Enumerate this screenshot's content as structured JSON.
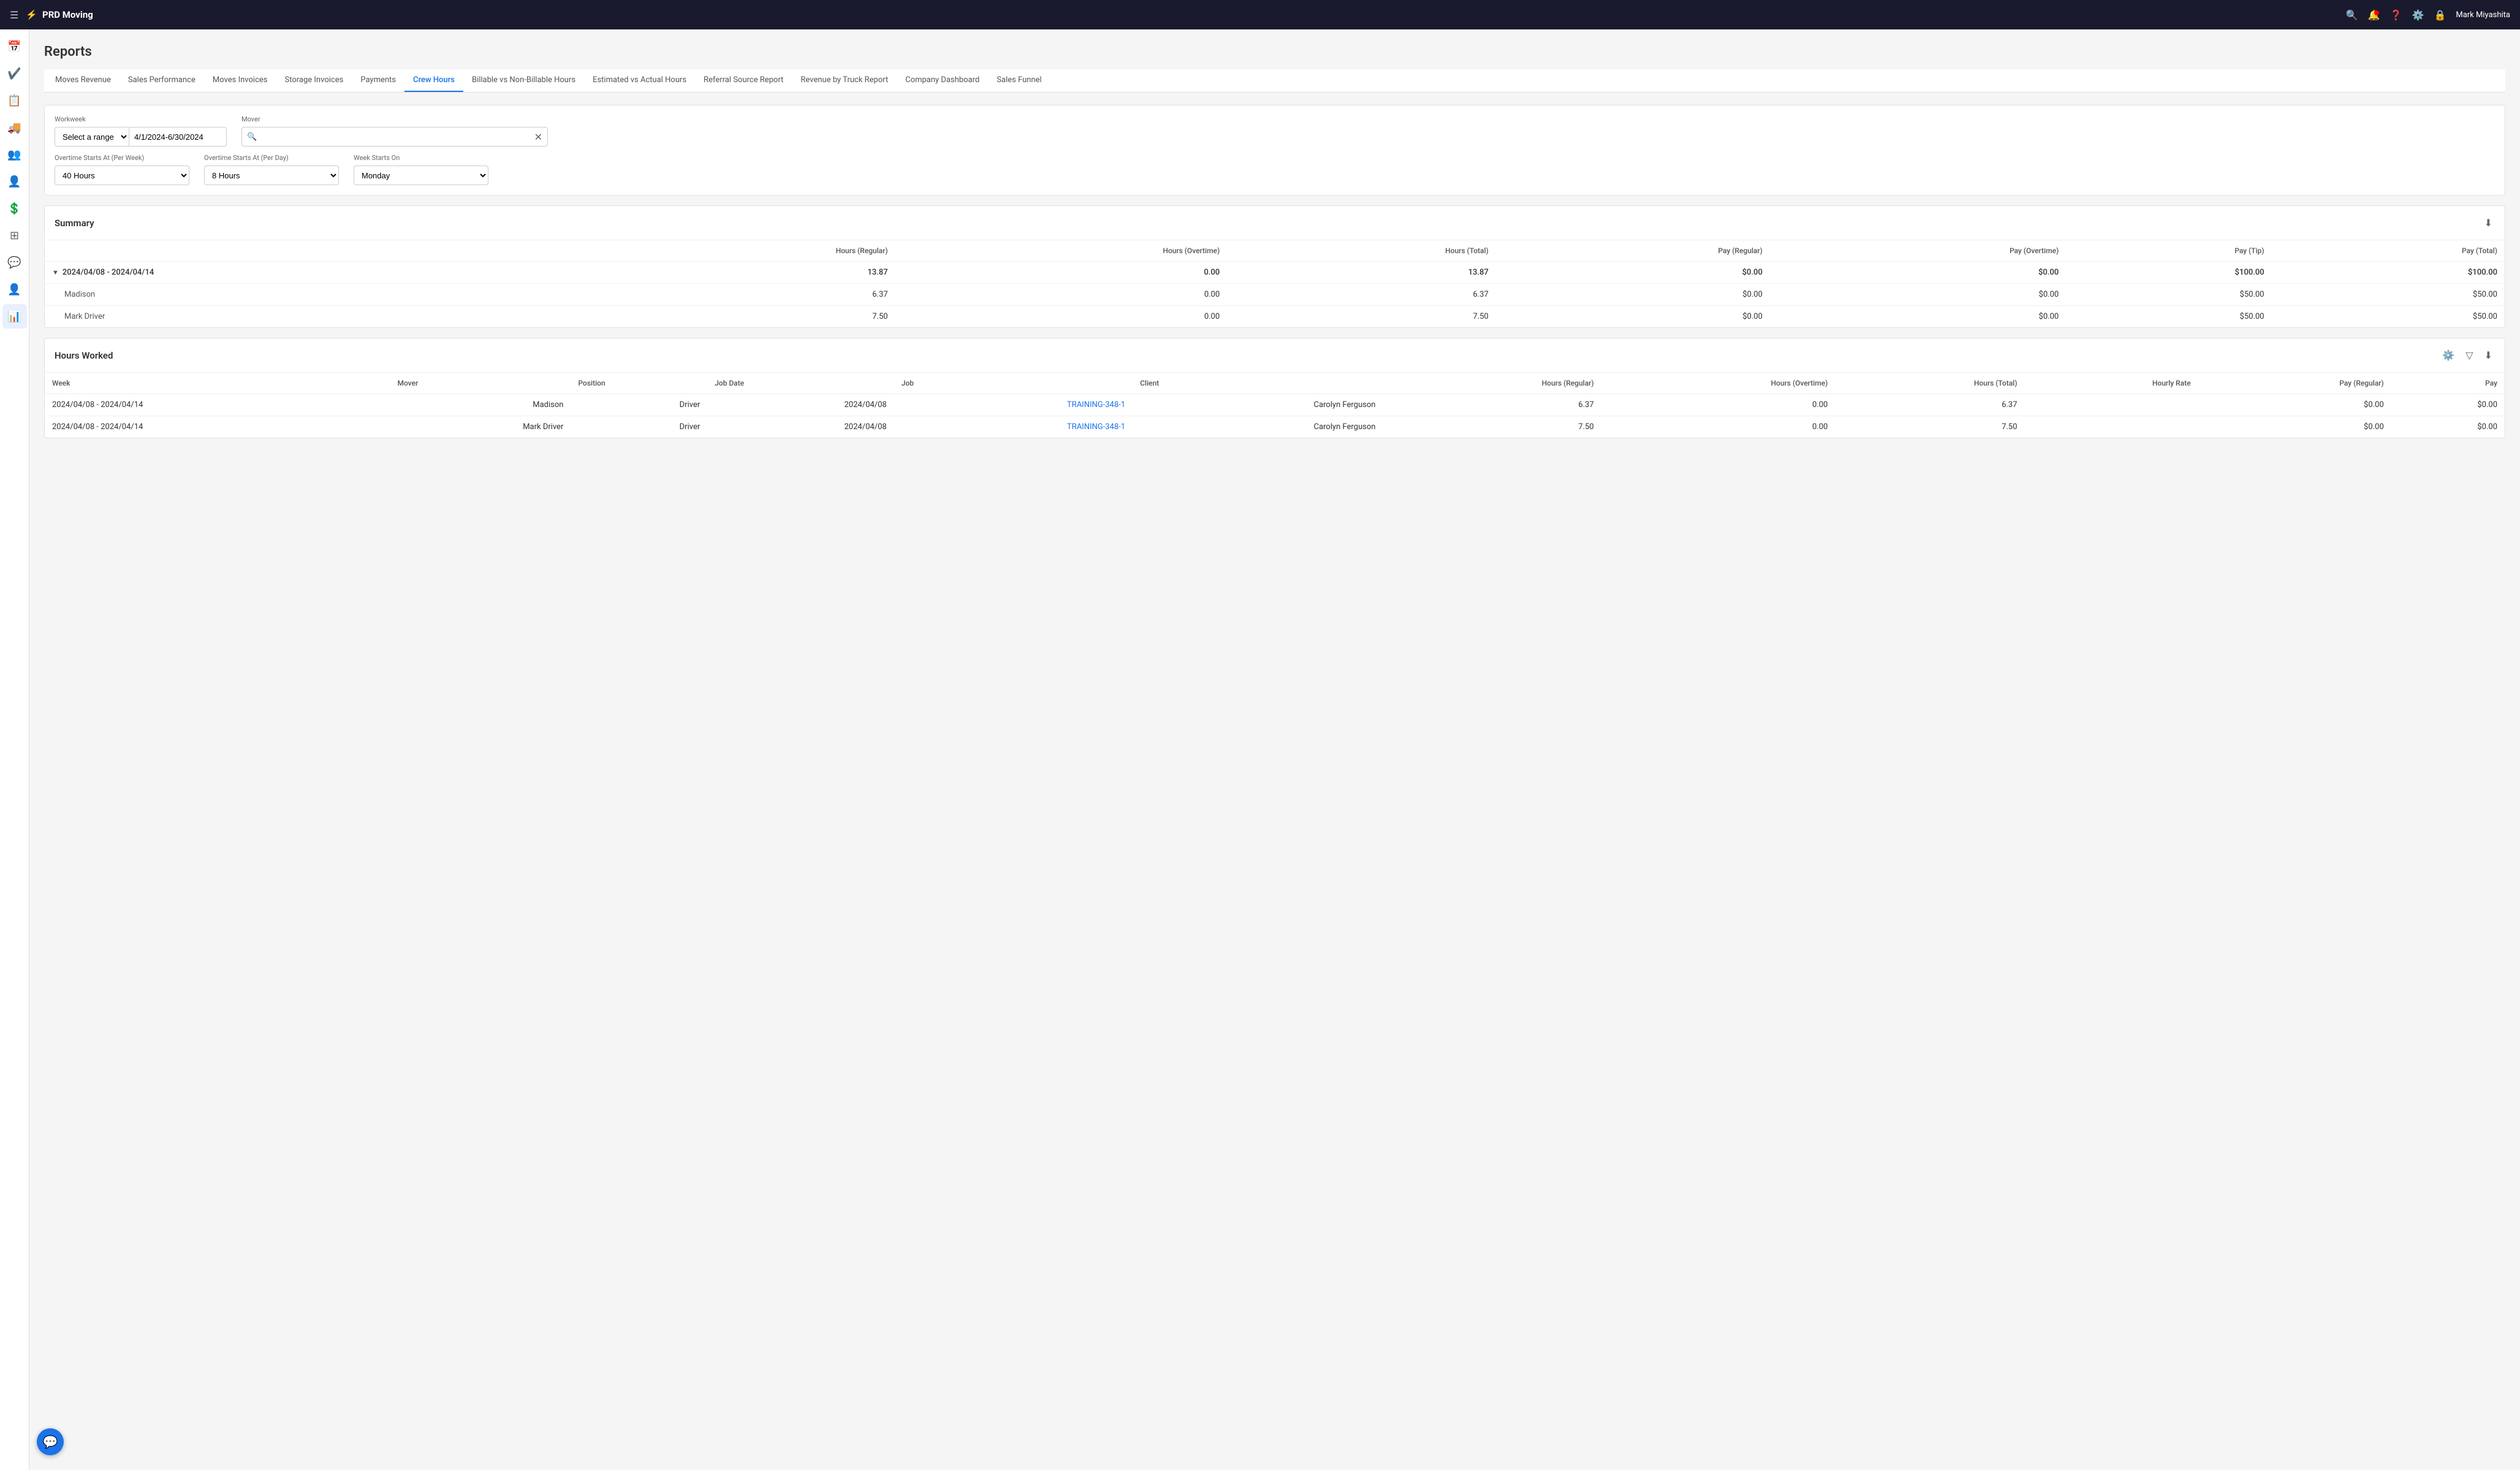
{
  "app": {
    "name": "PRD Moving",
    "user": "Mark Miyashita"
  },
  "sidebar": {
    "items": [
      {
        "id": "calendar",
        "icon": "📅",
        "label": "Calendar"
      },
      {
        "id": "check",
        "icon": "✔",
        "label": "Tasks"
      },
      {
        "id": "clipboard",
        "icon": "📋",
        "label": "Clipboard"
      },
      {
        "id": "truck",
        "icon": "🚚",
        "label": "Trucks"
      },
      {
        "id": "people",
        "icon": "👥",
        "label": "People"
      },
      {
        "id": "person",
        "icon": "👤",
        "label": "Person"
      },
      {
        "id": "dollar",
        "icon": "💲",
        "label": "Finance"
      },
      {
        "id": "grid",
        "icon": "⊞",
        "label": "Grid"
      },
      {
        "id": "chat",
        "icon": "💬",
        "label": "Chat"
      },
      {
        "id": "user",
        "icon": "👤",
        "label": "User"
      },
      {
        "id": "chart",
        "icon": "📊",
        "label": "Reports",
        "active": true
      }
    ]
  },
  "page": {
    "title": "Reports"
  },
  "tabs": [
    {
      "label": "Moves Revenue",
      "active": false
    },
    {
      "label": "Sales Performance",
      "active": false
    },
    {
      "label": "Moves Invoices",
      "active": false
    },
    {
      "label": "Storage Invoices",
      "active": false
    },
    {
      "label": "Payments",
      "active": false
    },
    {
      "label": "Crew Hours",
      "active": true
    },
    {
      "label": "Billable vs Non-Billable Hours",
      "active": false
    },
    {
      "label": "Estimated vs Actual Hours",
      "active": false
    },
    {
      "label": "Referral Source Report",
      "active": false
    },
    {
      "label": "Revenue by Truck Report",
      "active": false
    },
    {
      "label": "Company Dashboard",
      "active": false
    },
    {
      "label": "Sales Funnel",
      "active": false
    }
  ],
  "filters": {
    "workweek_label": "Workweek",
    "range_type": "Select a range",
    "range_date": "4/1/2024-6/30/2024",
    "mover_label": "Mover",
    "mover_placeholder": "",
    "overtime_week_label": "Overtime Starts At (Per Week)",
    "overtime_week_value": "40 Hours",
    "overtime_day_label": "Overtime Starts At (Per Day)",
    "overtime_day_value": "8 Hours",
    "week_starts_label": "Week Starts On",
    "week_starts_value": "Monday"
  },
  "summary": {
    "title": "Summary",
    "columns": [
      "Hours (Regular)",
      "Hours (Overtime)",
      "Hours (Total)",
      "Pay (Regular)",
      "Pay (Overtime)",
      "Pay (Tip)",
      "Pay (Total)"
    ],
    "groups": [
      {
        "label": "2024/04/08 - 2024/04/14",
        "values": [
          "13.87",
          "0.00",
          "13.87",
          "$0.00",
          "$0.00",
          "$100.00",
          "$100.00"
        ],
        "rows": [
          {
            "name": "Madison",
            "values": [
              "6.37",
              "0.00",
              "6.37",
              "$0.00",
              "$0.00",
              "$50.00",
              "$50.00"
            ]
          },
          {
            "name": "Mark Driver",
            "values": [
              "7.50",
              "0.00",
              "7.50",
              "$0.00",
              "$0.00",
              "$50.00",
              "$50.00"
            ]
          }
        ]
      }
    ]
  },
  "hours_worked": {
    "title": "Hours Worked",
    "columns": [
      "Week",
      "Mover",
      "Position",
      "Job Date",
      "Job",
      "Client",
      "Hours (Regular)",
      "Hours (Overtime)",
      "Hours (Total)",
      "Hourly Rate",
      "Pay (Regular)",
      "Pay"
    ],
    "rows": [
      {
        "week": "2024/04/08 - 2024/04/14",
        "mover": "Madison",
        "position": "Driver",
        "job_date": "2024/04/08",
        "job": "TRAINING-348-1",
        "client": "Carolyn Ferguson",
        "hours_regular": "6.37",
        "hours_overtime": "0.00",
        "hours_total": "6.37",
        "hourly_rate": "",
        "pay_regular": "$0.00",
        "pay": "$0.00"
      },
      {
        "week": "2024/04/08 - 2024/04/14",
        "mover": "Mark Driver",
        "position": "Driver",
        "job_date": "2024/04/08",
        "job": "TRAINING-348-1",
        "client": "Carolyn Ferguson",
        "hours_regular": "7.50",
        "hours_overtime": "0.00",
        "hours_total": "7.50",
        "hourly_rate": "",
        "pay_regular": "$0.00",
        "pay": "$0.00"
      }
    ]
  },
  "chat_btn_label": "💬"
}
